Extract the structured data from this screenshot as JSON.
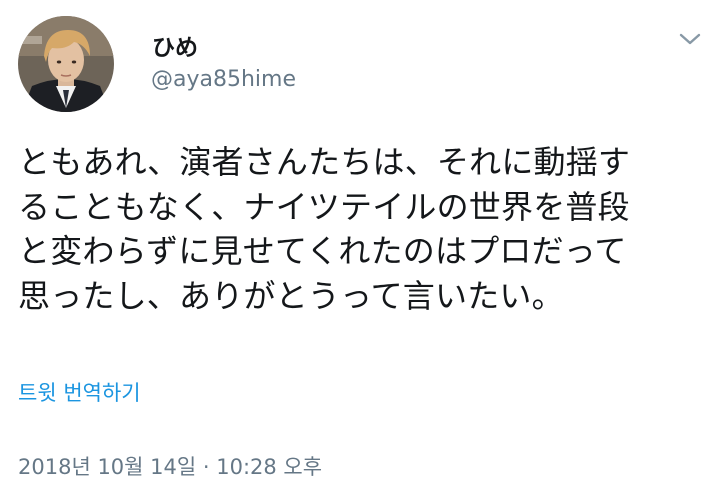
{
  "user": {
    "display_name": "ひめ",
    "handle": "@aya85hime",
    "avatar_icon": "profile-photo"
  },
  "tweet": {
    "text": "ともあれ、演者さんたちは、それに動揺す\nることもなく、ナイツテイルの世界を普段\nと変わらずに見せてくれたのはプロだって\n思ったし、ありがとうって言いたい。",
    "translate_label": "트윗 번역하기",
    "timestamp": "2018년 10월 14일 · 10:28 오후"
  },
  "menu": {
    "icon": "chevron-down-icon"
  },
  "colors": {
    "text": "#14171a",
    "secondary": "#657786",
    "link": "#1b95e0",
    "background": "#ffffff"
  }
}
